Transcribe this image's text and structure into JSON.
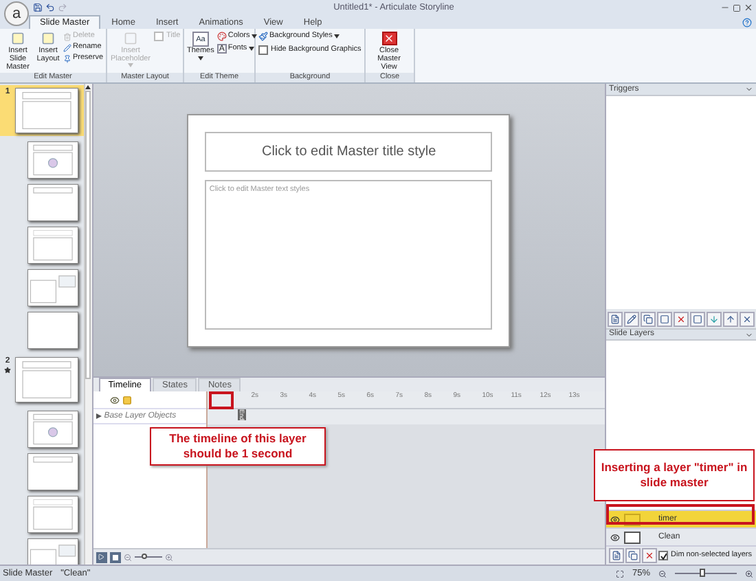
{
  "window": {
    "title": "Untitled1* - Articulate Storyline",
    "logo": "a"
  },
  "ribbon_tabs": [
    {
      "label": "Slide Master",
      "selected": true
    },
    {
      "label": "Home",
      "selected": false
    },
    {
      "label": "Insert",
      "selected": false
    },
    {
      "label": "Animations",
      "selected": false
    },
    {
      "label": "View",
      "selected": false
    },
    {
      "label": "Help",
      "selected": false
    }
  ],
  "ribbon": {
    "edit_master": {
      "label": "Edit Master",
      "insert_slide_master": "Insert Slide Master",
      "insert_layout": "Insert Layout",
      "small_buttons": [
        {
          "label": "Delete",
          "disabled": true
        },
        {
          "label": "Rename",
          "disabled": false
        },
        {
          "label": "Preserve",
          "disabled": false
        }
      ]
    },
    "master_layout": {
      "label": "Master Layout",
      "insert_placeholder": {
        "label": "Insert Placeholder",
        "disabled": true
      },
      "title_checkbox": {
        "label": "Title",
        "checked": false,
        "disabled": true
      }
    },
    "edit_theme": {
      "label": "Edit Theme",
      "themes": "Themes",
      "themes_icon_text": "Aa",
      "colors": "Colors",
      "fonts": "Fonts",
      "fonts_icon_text": "A"
    },
    "background": {
      "label": "Background",
      "background_styles": "Background Styles",
      "hide_background_graphics": {
        "label": "Hide Background Graphics",
        "checked": false
      }
    },
    "close": {
      "label": "Close",
      "close_master_view": "Close Master View"
    }
  },
  "slide_masters": [
    {
      "number": "1",
      "selected": true,
      "marked": false,
      "kind": "title_content",
      "layouts": [
        {
          "kind": "picture_content"
        },
        {
          "kind": "title_only"
        },
        {
          "kind": "content"
        },
        {
          "kind": "two_content"
        },
        {
          "kind": "blank"
        }
      ]
    },
    {
      "number": "2",
      "selected": false,
      "marked": true,
      "kind": "title_content",
      "layouts": [
        {
          "kind": "picture_content"
        },
        {
          "kind": "title_only"
        },
        {
          "kind": "content"
        },
        {
          "kind": "two_content"
        }
      ]
    }
  ],
  "slide": {
    "title_placeholder": "Click to edit Master title style",
    "body_placeholder": "Click to edit Master text styles"
  },
  "timeline": {
    "tabs": [
      {
        "label": "Timeline",
        "selected": true
      },
      {
        "label": "States",
        "selected": false
      },
      {
        "label": "Notes",
        "selected": false
      }
    ],
    "rows": [
      {
        "label": "Base Layer Objects",
        "expanded": false
      }
    ],
    "ruler_ticks": [
      "2s",
      "3s",
      "4s",
      "5s",
      "6s",
      "7s",
      "8s",
      "9s",
      "10s",
      "11s",
      "12s",
      "13s"
    ],
    "end_marker": "End",
    "zoom_slider": {
      "level": 0.35
    }
  },
  "triggers": {
    "title": "Triggers"
  },
  "slide_layers": {
    "title": "Slide Layers",
    "layers": [
      {
        "name": "timer",
        "selected": true
      },
      {
        "name": "Clean",
        "selected": false
      }
    ],
    "dim_non_selected": {
      "label": "Dim non-selected layers",
      "checked": true
    }
  },
  "status_bar": {
    "mode": "Slide Master",
    "layer": "\"Clean\"",
    "zoom": "75%",
    "zoom_slider": {
      "level": 0.45
    }
  },
  "annotations": [
    {
      "text": "The timeline of this layer should be 1 second"
    },
    {
      "text": "Inserting a layer \"timer\" in slide master"
    }
  ]
}
